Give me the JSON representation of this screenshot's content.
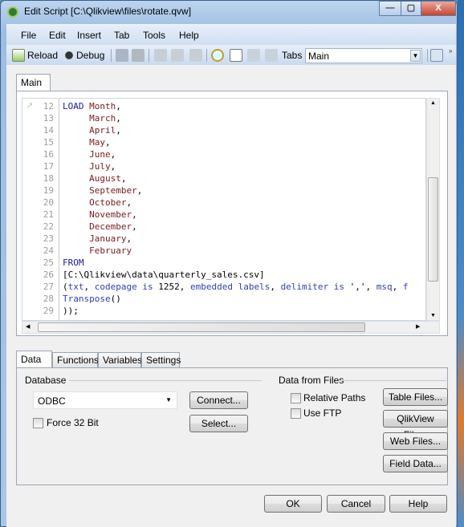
{
  "window": {
    "title": "Edit Script [C:\\Qlikview\\files\\rotate.qvw]",
    "minimize": "—",
    "maximize": "▢",
    "close": "X"
  },
  "menu": [
    "File",
    "Edit",
    "Insert",
    "Tab",
    "Tools",
    "Help"
  ],
  "toolbar": {
    "reload": "Reload",
    "debug": "Debug",
    "tabs_label": "Tabs",
    "tabs_value": "Main"
  },
  "editor": {
    "tab": "Main",
    "lines": [
      {
        "n": "12",
        "parts": [
          [
            "kw",
            "LOAD"
          ],
          [
            "txt",
            " "
          ],
          [
            "fld",
            "Month"
          ],
          [
            "txt",
            ","
          ]
        ]
      },
      {
        "n": "13",
        "parts": [
          [
            "txt",
            "     "
          ],
          [
            "fld",
            "March"
          ],
          [
            "txt",
            ","
          ]
        ]
      },
      {
        "n": "14",
        "parts": [
          [
            "txt",
            "     "
          ],
          [
            "fld",
            "April"
          ],
          [
            "txt",
            ","
          ]
        ]
      },
      {
        "n": "15",
        "parts": [
          [
            "txt",
            "     "
          ],
          [
            "fld",
            "May"
          ],
          [
            "txt",
            ","
          ]
        ]
      },
      {
        "n": "16",
        "parts": [
          [
            "txt",
            "     "
          ],
          [
            "fld",
            "June"
          ],
          [
            "txt",
            ","
          ]
        ]
      },
      {
        "n": "17",
        "parts": [
          [
            "txt",
            "     "
          ],
          [
            "fld",
            "July"
          ],
          [
            "txt",
            ","
          ]
        ]
      },
      {
        "n": "18",
        "parts": [
          [
            "txt",
            "     "
          ],
          [
            "fld",
            "August"
          ],
          [
            "txt",
            ","
          ]
        ]
      },
      {
        "n": "19",
        "parts": [
          [
            "txt",
            "     "
          ],
          [
            "fld",
            "September"
          ],
          [
            "txt",
            ","
          ]
        ]
      },
      {
        "n": "20",
        "parts": [
          [
            "txt",
            "     "
          ],
          [
            "fld",
            "October"
          ],
          [
            "txt",
            ","
          ]
        ]
      },
      {
        "n": "21",
        "parts": [
          [
            "txt",
            "     "
          ],
          [
            "fld",
            "November"
          ],
          [
            "txt",
            ","
          ]
        ]
      },
      {
        "n": "22",
        "parts": [
          [
            "txt",
            "     "
          ],
          [
            "fld",
            "December"
          ],
          [
            "txt",
            ","
          ]
        ]
      },
      {
        "n": "23",
        "parts": [
          [
            "txt",
            "     "
          ],
          [
            "fld",
            "January"
          ],
          [
            "txt",
            ","
          ]
        ]
      },
      {
        "n": "24",
        "parts": [
          [
            "txt",
            "     "
          ],
          [
            "fld",
            "February"
          ]
        ]
      },
      {
        "n": "25",
        "parts": [
          [
            "kw",
            "FROM"
          ]
        ]
      },
      {
        "n": "26",
        "parts": [
          [
            "txt",
            "[C:\\Qlikview\\data\\quarterly_sales.csv]"
          ]
        ]
      },
      {
        "n": "27",
        "parts": [
          [
            "txt",
            "("
          ],
          [
            "fn",
            "txt"
          ],
          [
            "txt",
            ", "
          ],
          [
            "fn",
            "codepage is"
          ],
          [
            "txt",
            " 1252, "
          ],
          [
            "fn",
            "embedded labels"
          ],
          [
            "txt",
            ", "
          ],
          [
            "fn",
            "delimiter is"
          ],
          [
            "txt",
            " ',', "
          ],
          [
            "fn",
            "msq"
          ],
          [
            "txt",
            ", "
          ],
          [
            "fn",
            "f"
          ]
        ]
      },
      {
        "n": "28",
        "parts": [
          [
            "fn",
            "Transpose"
          ],
          [
            "txt",
            "()"
          ]
        ]
      },
      {
        "n": "29",
        "parts": [
          [
            "txt",
            "));"
          ]
        ]
      }
    ]
  },
  "bottom_tabs": [
    "Data",
    "Functions",
    "Variables",
    "Settings"
  ],
  "database": {
    "label": "Database",
    "selected": "ODBC",
    "connect": "Connect...",
    "select": "Select...",
    "force32": "Force 32 Bit"
  },
  "files": {
    "label": "Data from Files",
    "relative_paths": "Relative Paths",
    "use_ftp": "Use FTP",
    "table_files": "Table Files...",
    "qlikview_file": "QlikView File...",
    "web_files": "Web Files...",
    "field_data": "Field Data..."
  },
  "dialog": {
    "ok": "OK",
    "cancel": "Cancel",
    "help": "Help"
  }
}
